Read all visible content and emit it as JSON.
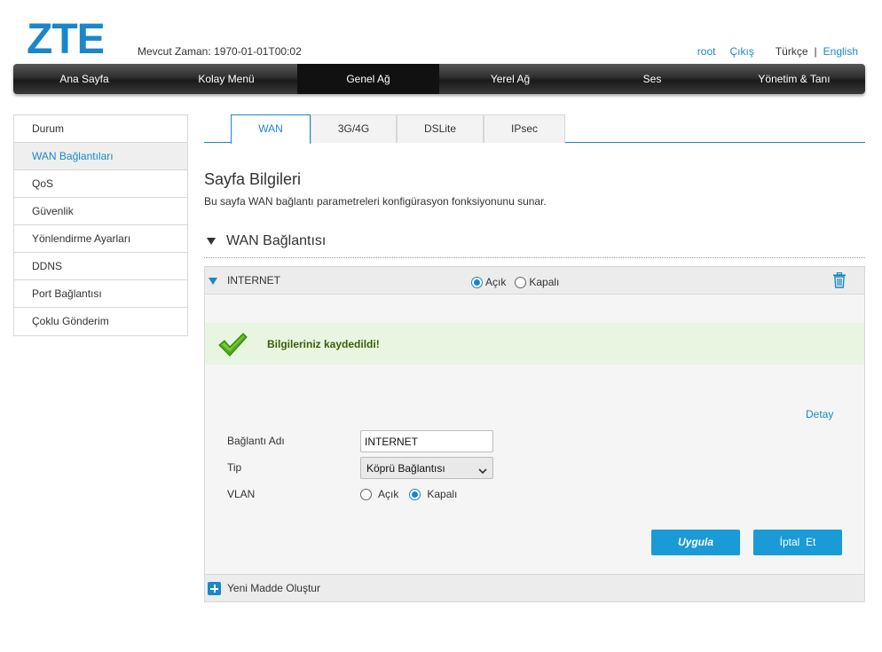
{
  "header": {
    "logo_text": "ZTE",
    "time_label": "Mevcut Zaman: 1970-01-01T00:02",
    "user": "root",
    "logout": "Çıkış",
    "lang_current": "Türkçe",
    "lang_separator": "|",
    "lang_other": "English"
  },
  "nav": {
    "items": [
      "Ana Sayfa",
      "Kolay Menü",
      "Genel Ağ",
      "Yerel Ağ",
      "Ses",
      "Yönetim & Tanı"
    ],
    "active": "Genel Ağ"
  },
  "sidebar": {
    "items": [
      "Durum",
      "WAN Bağlantıları",
      "QoS",
      "Güvenlik",
      "Yönlendirme Ayarları",
      "DDNS",
      "Port Bağlantısı",
      "Çoklu Gönderim"
    ],
    "active": "WAN Bağlantıları"
  },
  "tabs": {
    "items": [
      "WAN",
      "3G/4G",
      "DSLite",
      "IPsec"
    ],
    "active": "WAN"
  },
  "page": {
    "title": "Sayfa Bilgileri",
    "description": "Bu sayfa WAN bağlantı parametreleri konfigürasyon fonksiyonunu sunar.",
    "section_title": "WAN Bağlantısı"
  },
  "connection": {
    "name": "INTERNET",
    "on_label": "Açık",
    "off_label": "Kapalı",
    "enabled": "Açık",
    "success_message": "Bilgileriniz kaydedildi!",
    "detail_link": "Detay",
    "fields": {
      "name_label": "Bağlantı Adı",
      "name_value": "INTERNET",
      "type_label": "Tip",
      "type_value": "Köprü Bağlantısı",
      "vlan_label": "VLAN",
      "vlan_on": "Açık",
      "vlan_off": "Kapalı",
      "vlan_selected": "Kapalı"
    },
    "apply_button": "Uygula",
    "cancel_button": "İptal  Et",
    "add_new": "Yeni Madde Oluştur"
  },
  "colors": {
    "accent": "#1a87c9",
    "button": "#1a9ad6",
    "success_bg": "#e8f5e0",
    "success_text": "#3a5f0b"
  },
  "icons": {
    "trash": "trash-icon",
    "check": "check-icon",
    "add": "plus-icon",
    "collapse": "triangle-down-icon"
  }
}
